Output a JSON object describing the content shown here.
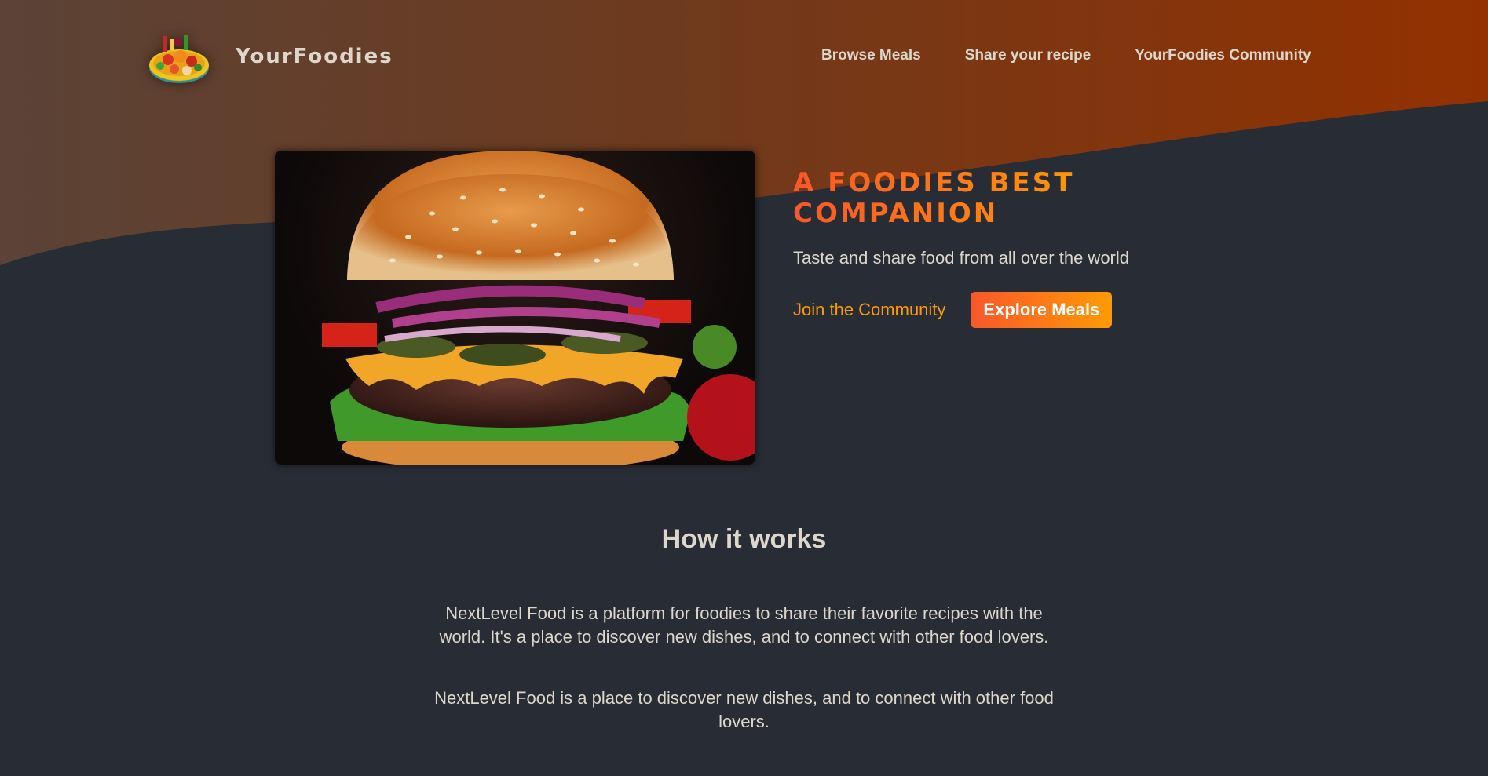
{
  "header": {
    "logo_alt": "A plate with food on it",
    "brand": "YourFoodies",
    "nav": [
      {
        "label": "Browse Meals"
      },
      {
        "label": "Share your recipe"
      },
      {
        "label": "YourFoodies Community"
      }
    ]
  },
  "hero": {
    "image_alt": "A delicious burger with cheese, onions, pickles and lettuce",
    "title": "A Foodies Best Companion",
    "subtitle": "Taste and share food from all over the world",
    "join_link": "Join the Community",
    "explore_button": "Explore Meals"
  },
  "how_it_works": {
    "heading": "How it works",
    "paragraphs": [
      "NextLevel Food is a platform for foodies to share their favorite recipes with the world. It's a place to discover new dishes, and to connect with other food lovers.",
      "NextLevel Food is a place to discover new dishes, and to connect with other food lovers."
    ]
  },
  "colors": {
    "background": "#282c35",
    "accent_start": "#f9572a",
    "accent_end": "#ff9b05",
    "text": "#ddd6cb",
    "wave_left": "#5b4337",
    "wave_right": "#923000"
  }
}
